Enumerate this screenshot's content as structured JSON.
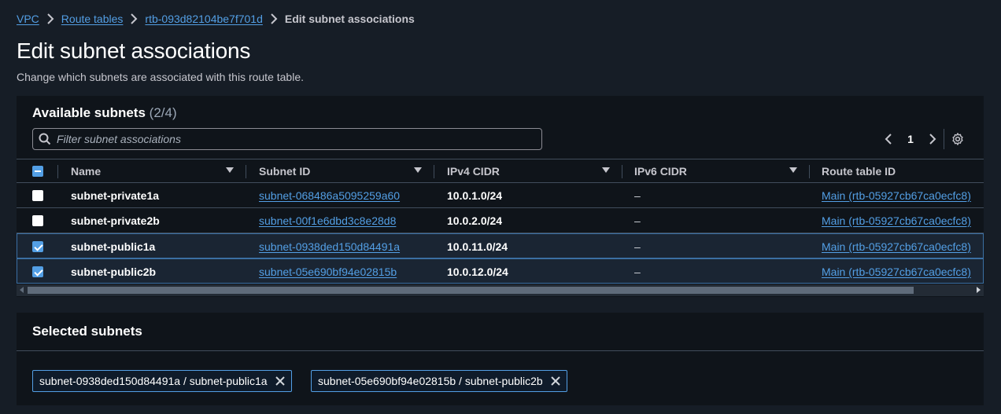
{
  "breadcrumb": {
    "items": [
      "VPC",
      "Route tables",
      "rtb-093d82104be7f701d"
    ],
    "current": "Edit subnet associations"
  },
  "page": {
    "title": "Edit subnet associations",
    "description": "Change which subnets are associated with this route table."
  },
  "available": {
    "heading": "Available subnets",
    "count": "(2/4)",
    "filter_placeholder": "Filter subnet associations",
    "page_number": "1",
    "columns": [
      "Name",
      "Subnet ID",
      "IPv4 CIDR",
      "IPv6 CIDR",
      "Route table ID"
    ],
    "rows": [
      {
        "name": "subnet-private1a",
        "subnet_id": "subnet-068486a5095259a60",
        "ipv4": "10.0.1.0/24",
        "ipv6": "–",
        "route_table": "Main (rtb-05927cb67ca0ecfc8)",
        "checked": false
      },
      {
        "name": "subnet-private2b",
        "subnet_id": "subnet-00f1e6dbd3c8e28d8",
        "ipv4": "10.0.2.0/24",
        "ipv6": "–",
        "route_table": "Main (rtb-05927cb67ca0ecfc8)",
        "checked": false
      },
      {
        "name": "subnet-public1a",
        "subnet_id": "subnet-0938ded150d84491a",
        "ipv4": "10.0.11.0/24",
        "ipv6": "–",
        "route_table": "Main (rtb-05927cb67ca0ecfc8)",
        "checked": true
      },
      {
        "name": "subnet-public2b",
        "subnet_id": "subnet-05e690bf94e02815b",
        "ipv4": "10.0.12.0/24",
        "ipv6": "–",
        "route_table": "Main (rtb-05927cb67ca0ecfc8)",
        "checked": true
      }
    ]
  },
  "selected": {
    "heading": "Selected subnets",
    "tokens": [
      "subnet-0938ded150d84491a / subnet-public1a",
      "subnet-05e690bf94e02815b / subnet-public2b"
    ]
  },
  "colors": {
    "background": "#161d26",
    "panel": "#0f141a",
    "link": "#539fe5",
    "selected_row": "#1a2533"
  }
}
